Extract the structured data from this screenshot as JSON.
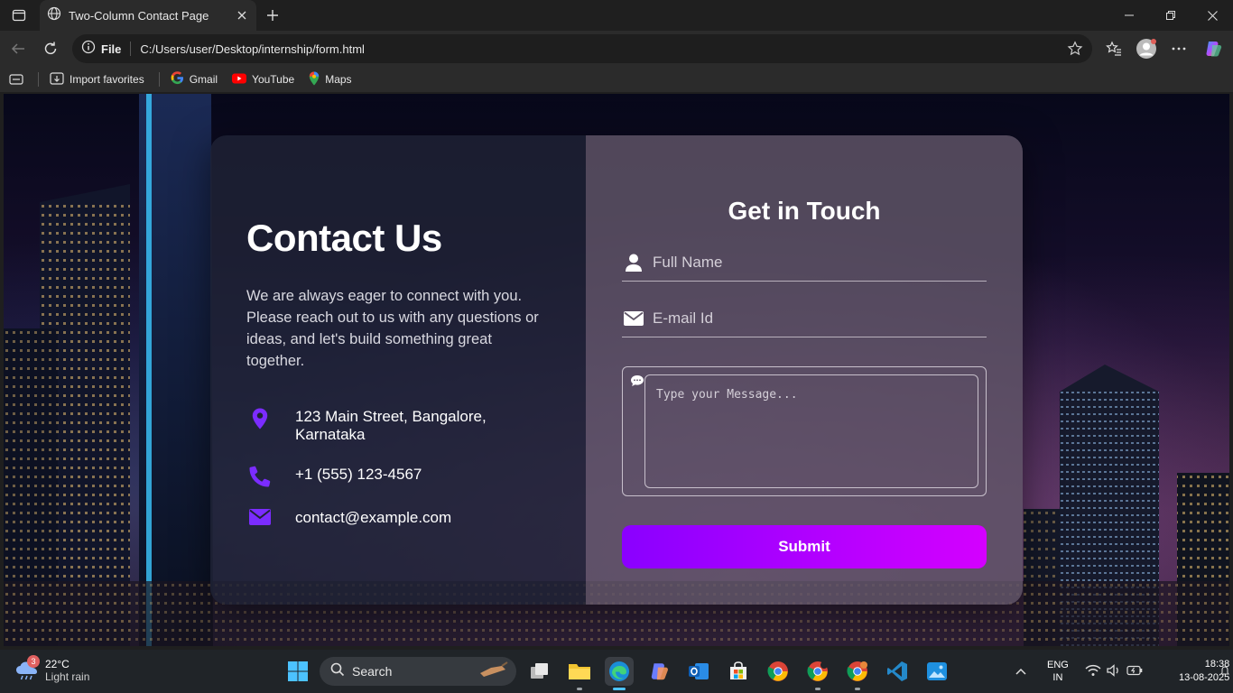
{
  "browser": {
    "tab_title": "Two-Column Contact Page",
    "address_scheme": "File",
    "address_url": "C:/Users/user/Desktop/internship/form.html",
    "favorites": [
      {
        "label": "Import favorites",
        "icon": "import-icon"
      },
      {
        "label": "Gmail",
        "icon": "google-icon"
      },
      {
        "label": "YouTube",
        "icon": "youtube-icon"
      },
      {
        "label": "Maps",
        "icon": "maps-pin-icon"
      }
    ]
  },
  "page": {
    "left": {
      "title": "Contact Us",
      "description": "We are always eager to connect with you. Please reach out to us with any questions or ideas, and let's build something great together.",
      "address_line1": "123 Main Street, Bangalore,",
      "address_line2": "Karnataka",
      "phone": "+1 (555) 123-4567",
      "email": "contact@example.com",
      "icon_color": "#7b2cff"
    },
    "right": {
      "title": "Get in Touch",
      "name_placeholder": "Full Name",
      "email_placeholder": "E-mail Id",
      "message_placeholder": "Type your Message...",
      "submit_label": "Submit",
      "button_gradient_start": "#8a00ff",
      "button_gradient_end": "#d400ff"
    }
  },
  "taskbar": {
    "weather_badge": "3",
    "temperature": "22°C",
    "condition": "Light rain",
    "search_label": "Search",
    "lang_line1": "ENG",
    "lang_line2": "IN",
    "time": "18:38",
    "date": "13-08-2025"
  }
}
